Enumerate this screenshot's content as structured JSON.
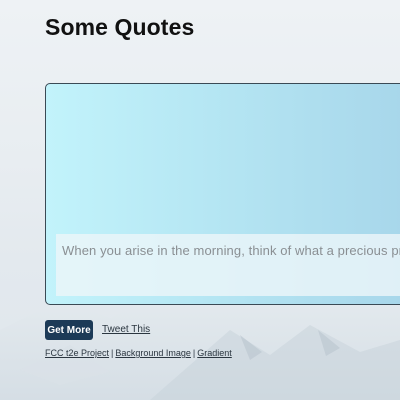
{
  "header": {
    "title": "Some Quotes"
  },
  "quote": {
    "text": "When you arise in the morning, think of what a precious privilege it is to be alive"
  },
  "actions": {
    "get_more_label": "Get More",
    "tweet_label": "Tweet This"
  },
  "footer": {
    "links": [
      "FCC t2e Project",
      "Background Image",
      "Gradient"
    ],
    "separator": "|"
  },
  "colors": {
    "button_bg": "#1c3a57",
    "card_gradient_start": "#c2f3fb",
    "card_gradient_end": "#a7d6ea",
    "quote_text": "#8a8f93"
  }
}
